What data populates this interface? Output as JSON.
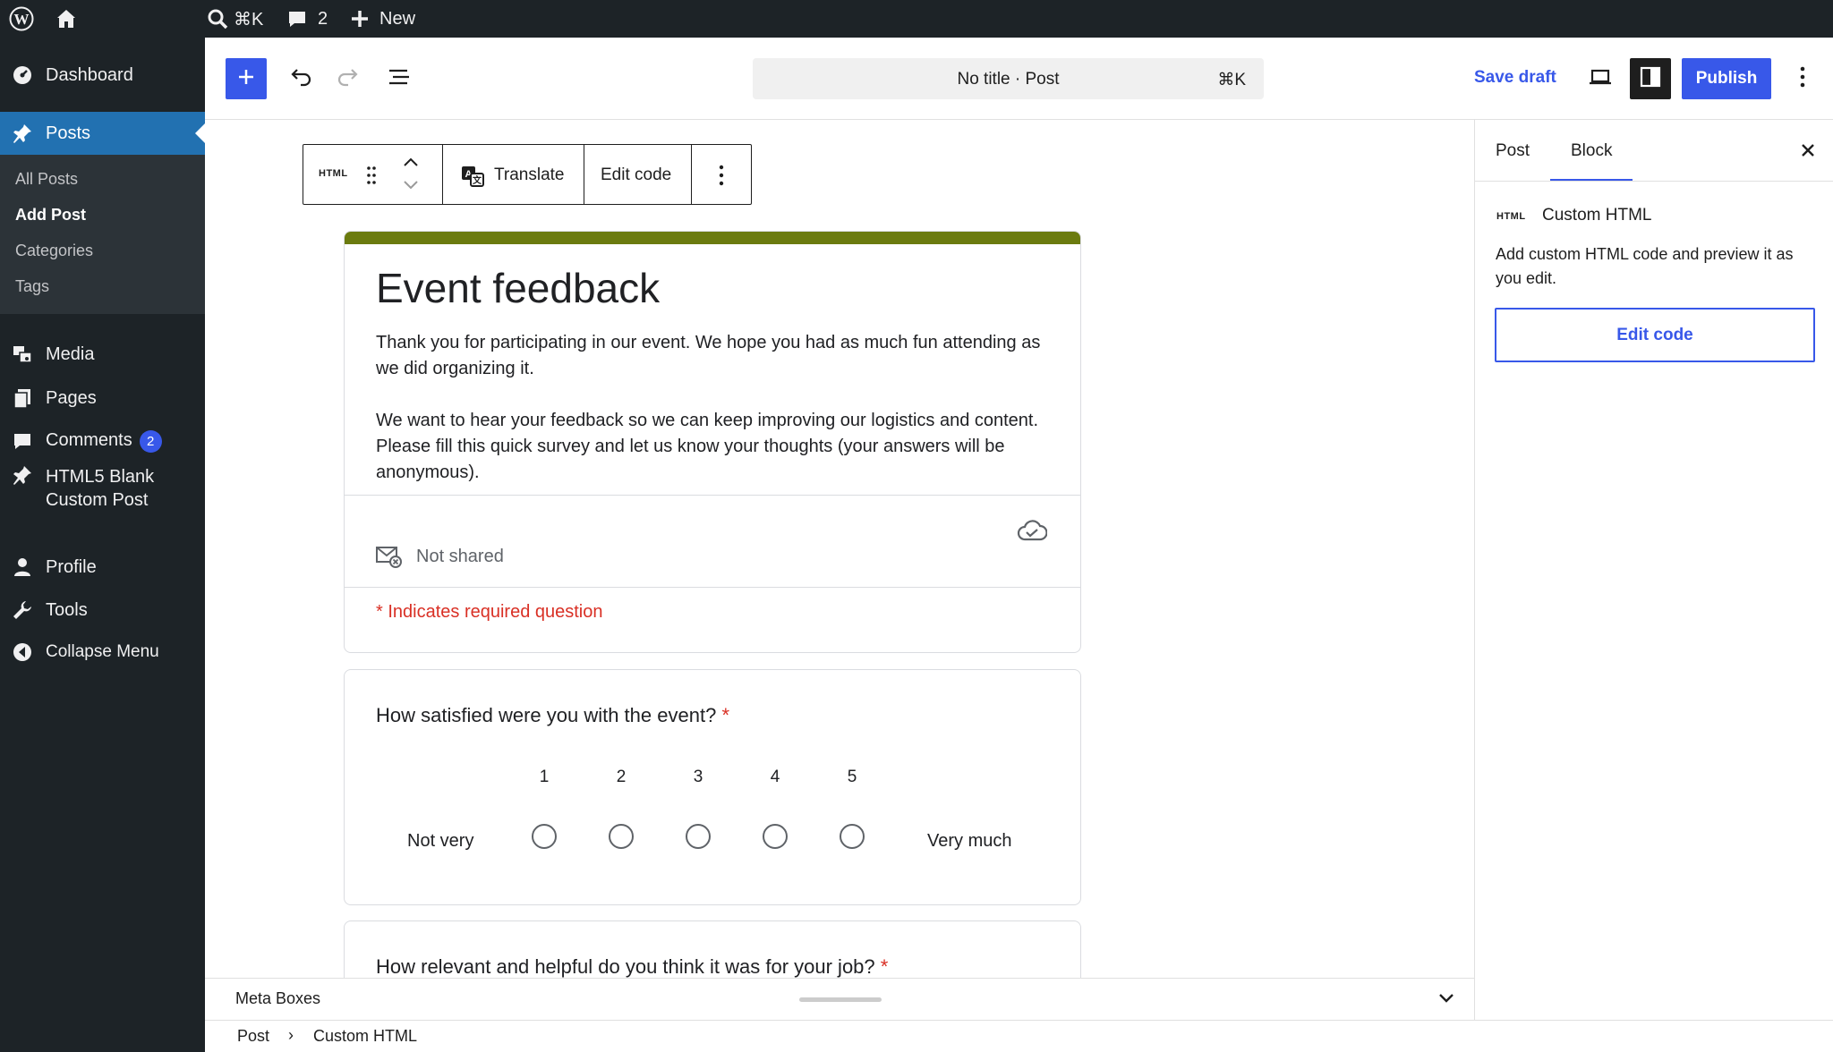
{
  "admin_bar": {
    "search_shortcut": "⌘K",
    "comments_count": "2",
    "new_label": "New"
  },
  "sidebar": {
    "dashboard": "Dashboard",
    "posts": "Posts",
    "posts_sub": {
      "all_posts": "All Posts",
      "add_post": "Add Post",
      "categories": "Categories",
      "tags": "Tags"
    },
    "media": "Media",
    "pages": "Pages",
    "comments": "Comments",
    "comments_badge": "2",
    "custom_post_line1": "HTML5 Blank",
    "custom_post_line2": "Custom Post",
    "profile": "Profile",
    "tools": "Tools",
    "collapse": "Collapse Menu"
  },
  "header": {
    "doc_title": "No title · Post",
    "doc_shortcut": "⌘K",
    "save_draft": "Save draft",
    "publish": "Publish"
  },
  "block_toolbar": {
    "block_icon_text": "HTML",
    "translate": "Translate",
    "edit_code": "Edit code"
  },
  "form": {
    "title": "Event feedback",
    "desc_p1": "Thank you for participating in our event. We hope you had as much fun attending as we did organizing it.",
    "desc_p2": "We want to hear your feedback so we can keep improving our logistics and content. Please fill this quick survey and let us know your thoughts (your answers will be anonymous).",
    "not_shared": "Not shared",
    "required_note": "* Indicates required question",
    "q1": "How satisfied were you with the event?",
    "q1_star": "*",
    "scale": [
      "1",
      "2",
      "3",
      "4",
      "5"
    ],
    "scale_low": "Not very",
    "scale_high": "Very much",
    "q2": "How relevant and helpful do you think it was for your job?",
    "q2_star": "*"
  },
  "meta_boxes": {
    "label": "Meta Boxes"
  },
  "footer": {
    "crumb_post": "Post",
    "crumb_sep": "›",
    "crumb_block": "Custom HTML"
  },
  "panel": {
    "tab_post": "Post",
    "tab_block": "Block",
    "block_icon_text": "HTML",
    "block_name": "Custom HTML",
    "block_desc": "Add custom HTML code and preview it as you edit.",
    "edit_code": "Edit code"
  },
  "colors": {
    "accent": "#3858e9",
    "admin_bg": "#1d2327",
    "wp_blue": "#2271b1",
    "form_header": "#6b7b0f",
    "required_red": "#d93025"
  }
}
